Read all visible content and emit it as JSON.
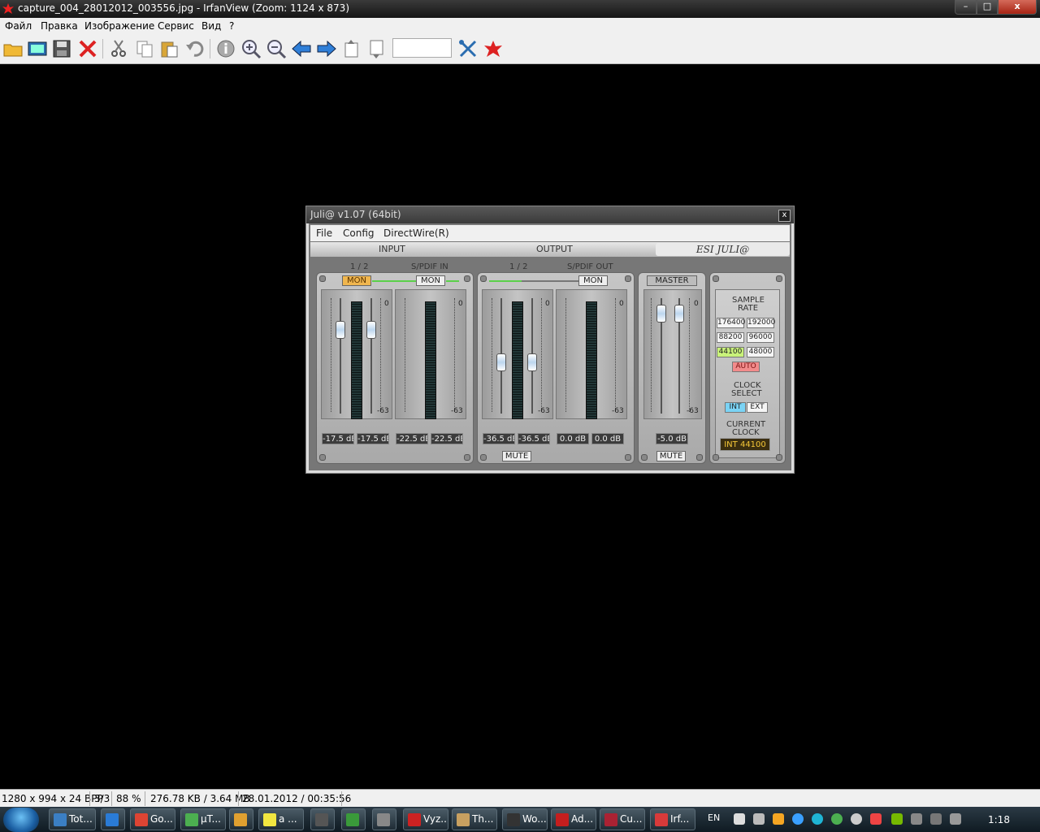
{
  "window": {
    "title": "capture_004_28012012_003556.jpg - IrfanView (Zoom: 1124 x 873)",
    "min": "–",
    "max": "□",
    "close": "x"
  },
  "menu": [
    "Файл",
    "Правка",
    "Изображение",
    "Сервис",
    "Вид",
    "?"
  ],
  "toolbar": {
    "icons": [
      "open-folder-icon",
      "slideshow-icon",
      "save-icon",
      "delete-icon",
      "cut-icon",
      "copy-icon",
      "paste-icon",
      "undo-icon",
      "info-icon",
      "zoom-in-icon",
      "zoom-out-icon",
      "prev-icon",
      "next-icon",
      "page-prev-icon",
      "page-next-icon",
      "settings-icon",
      "exit-icon"
    ],
    "page_input": ""
  },
  "juli": {
    "title": "Juli@ v1.07 (64bit)",
    "close": "x",
    "menu": [
      "File",
      "Config",
      "DirectWire(R)"
    ],
    "sections": {
      "input": "INPUT",
      "output": "OUTPUT",
      "brand": "ESI  JULI@"
    },
    "input": {
      "ch12": "1 / 2",
      "spdif_in": "S/PDIF IN",
      "mon1": "MON",
      "mon2": "MON",
      "db": [
        "-17.5 dB",
        "-17.5 dB",
        "-22.5 dB",
        "-22.5 dB"
      ],
      "fader_levels": [
        0.25,
        0.25
      ]
    },
    "output": {
      "ch12": "1 / 2",
      "spdif_out": "S/PDIF OUT",
      "mon": "MON",
      "mute": "MUTE",
      "db": [
        "-36.5 dB",
        "-36.5 dB",
        "0.0 dB",
        "0.0 dB"
      ],
      "fader_levels": [
        0.58,
        0.58
      ]
    },
    "master": {
      "label": "MASTER",
      "db": "-5.0 dB",
      "mute": "MUTE",
      "fader_levels": [
        0.08,
        0.08
      ]
    },
    "scale": {
      "top": "0",
      "bottom": "-63"
    },
    "clock": {
      "sample_rate": [
        "SAMPLE",
        "RATE"
      ],
      "rates": [
        "176400",
        "192000",
        "88200",
        "96000",
        "44100",
        "48000"
      ],
      "auto": "AUTO",
      "clock_select": [
        "CLOCK",
        "SELECT"
      ],
      "int": "INT",
      "ext": "EXT",
      "current_clock": [
        "CURRENT",
        "CLOCK"
      ],
      "current": "INT 44100"
    }
  },
  "status": [
    "1280 x 994 x 24 BPP",
    "3/3",
    "88 %",
    "276.78 KB / 3.64 MB",
    "28.01.2012 / 00:35:56"
  ],
  "taskbar": {
    "tasks": [
      {
        "label": "Tot...",
        "color": "#3b7fc4"
      },
      {
        "label": "",
        "color": "#2a7bd6"
      },
      {
        "label": "Go...",
        "color": "#dd4433"
      },
      {
        "label": "µT...",
        "color": "#4caf50"
      },
      {
        "label": "",
        "color": "#e0a030"
      },
      {
        "label": "а ...",
        "color": "#f2e640"
      },
      {
        "label": "",
        "color": "#555555"
      },
      {
        "label": "",
        "color": "#3a9a3a"
      },
      {
        "label": "",
        "color": "#888888"
      },
      {
        "label": "Vyz...",
        "color": "#cc2222"
      },
      {
        "label": "Th...",
        "color": "#c8a060"
      },
      {
        "label": "Wo...",
        "color": "#333333"
      },
      {
        "label": "Ad...",
        "color": "#c41e1e"
      },
      {
        "label": "Cu...",
        "color": "#aa2233"
      },
      {
        "label": "Irf...",
        "color": "#d83a3a"
      }
    ],
    "lang": "EN",
    "clock": "1:18"
  }
}
